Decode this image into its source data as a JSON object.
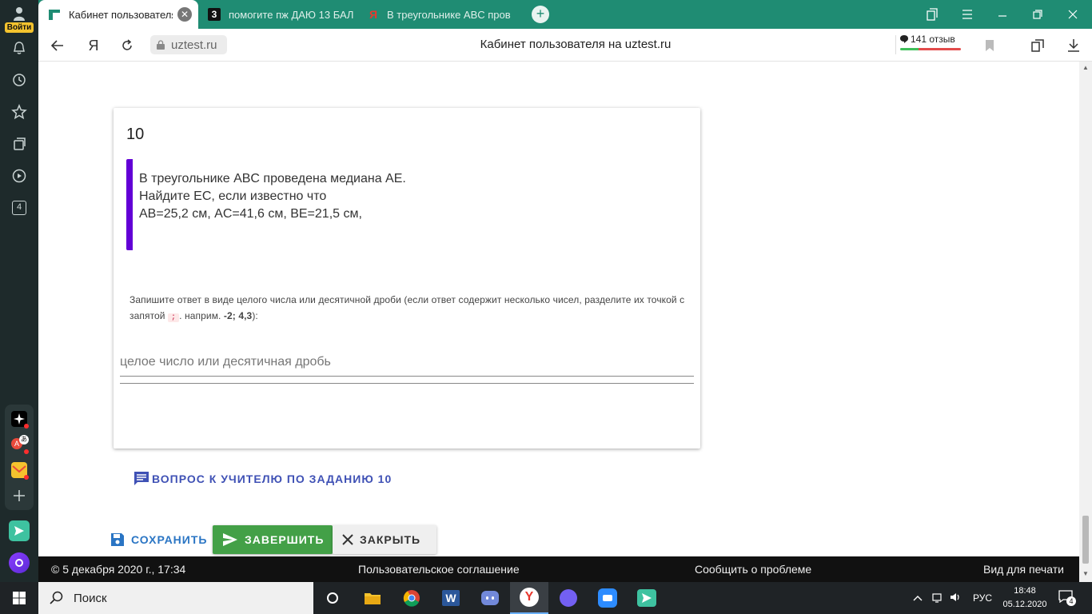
{
  "sidebar": {
    "login_label": "Войти",
    "counter_badge": "4"
  },
  "tabs": [
    {
      "title": "Кабинет пользователя",
      "favicon_color": "#1f8c73",
      "active": true
    },
    {
      "title": "помогите пж ДАЮ 13 БАЛ",
      "favicon_color": "#111111"
    },
    {
      "title": "В треугольнике ABC пров",
      "favicon_color": "#e8382e"
    }
  ],
  "address_bar": {
    "url": "uztest.ru",
    "page_title": "Кабинет пользователя на uztest.ru",
    "reviews_label": "141 отзыв"
  },
  "question": {
    "number": "10",
    "text_line1": "В треугольнике ABC проведена медиана AE.",
    "text_line2": "Найдите EC, если известно что",
    "text_line3": "AB=25,2 см, AC=41,6 см, BE=21,5 см,"
  },
  "instructions": {
    "text_part1": "Запишите ответ в виде целого числа или десятичной дроби (если ответ содержит несколько чисел, разделите их точкой с запятой ",
    "separator": ";",
    "text_part2": ". наприм. ",
    "example": "-2; 4,3",
    "text_part3": "):"
  },
  "answer": {
    "placeholder": "целое число или десятичная дробь",
    "value": ""
  },
  "ask_teacher_label": "ВОПРОС К УЧИТЕЛЮ ПО ЗАДАНИЮ 10",
  "actions": {
    "save_label": "СОХРАНИТЬ",
    "finish_label": "ЗАВЕРШИТЬ",
    "close_label": "ЗАКРЫТЬ"
  },
  "footer": {
    "timestamp": "© 5 декабря 2020 г., 17:34",
    "agreement": "Пользовательское соглашение",
    "report": "Сообщить о проблеме",
    "print_view": "Вид для печати"
  },
  "taskbar": {
    "search_label": "Поиск",
    "language": "РУС",
    "time": "18:48",
    "date": "05.12.2020",
    "notifications": "4"
  },
  "colors": {
    "accent_green": "#1f8c73",
    "question_border": "#6200d6",
    "finish_button": "#43a047",
    "link_blue": "#3f51b5"
  }
}
